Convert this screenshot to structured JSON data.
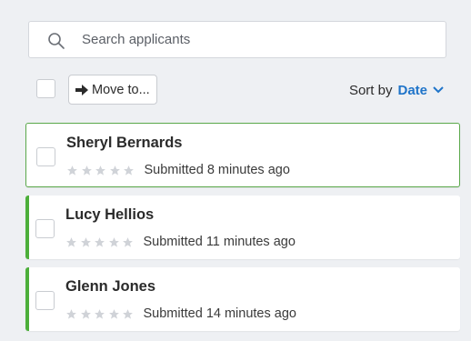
{
  "search": {
    "placeholder": "Search applicants"
  },
  "toolbar": {
    "move_label": "Move to..."
  },
  "sort": {
    "label": "Sort by",
    "value": "Date"
  },
  "applicants": [
    {
      "name": "Sheryl Bernards",
      "submitted": "Submitted 8 minutes ago",
      "rating": 0
    },
    {
      "name": "Lucy Hellios",
      "submitted": "Submitted 11 minutes ago",
      "rating": 0
    },
    {
      "name": "Glenn Jones",
      "submitted": "Submitted 14 minutes ago",
      "rating": 0
    }
  ],
  "colors": {
    "accent": "#1f74c9",
    "marker": "#4caf3a",
    "active_border": "#5aa84a",
    "star_empty": "#d0d3d8"
  },
  "icons": {
    "search": "search-icon",
    "move": "arrow-right-icon",
    "sort": "chevron-down-icon",
    "rating": "star-icon"
  }
}
